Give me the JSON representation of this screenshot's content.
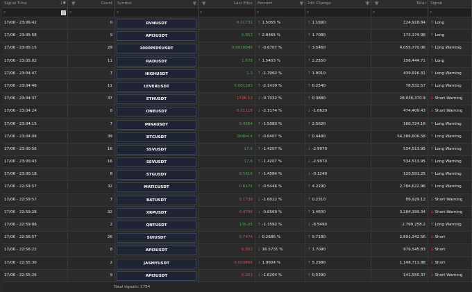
{
  "headers": [
    "Signal Time",
    "",
    "Count",
    "Symbol",
    "",
    "Last Price",
    "Percent",
    "",
    "24h Change",
    "",
    "Total",
    "Signal"
  ],
  "footer": {
    "total_label": "Total signals: 1754"
  },
  "rows": [
    {
      "time": "17/06 - 23:06:42",
      "count": "0",
      "symbol": "RVNUSDT",
      "price": "0.01731",
      "pc": "g",
      "pct_dir": "up",
      "pct": "1.5055 %",
      "ch_dir": "up",
      "change": "1.1690",
      "total": "124,918.84",
      "sig_dir": "up",
      "signal": "Long"
    },
    {
      "time": "17/06 - 23:05:58",
      "count": "9",
      "symbol": "API3USDT",
      "price": "0.953",
      "pc": "g",
      "pct_dir": "up",
      "pct": "2.8465 %",
      "ch_dir": "up",
      "change": "1.7080",
      "total": "173,174.98",
      "sig_dir": "up",
      "signal": "Long"
    },
    {
      "time": "17/06 - 23:05:15",
      "count": "29",
      "symbol": "1000PEPEUSDT",
      "price": "0.0010046",
      "pc": "g",
      "pct_dir": "up",
      "pct": "-0.6707 %",
      "ch_dir": "up",
      "change": "3.5460",
      "total": "4,055,770.06",
      "sig_dir": "up",
      "signal": "Long Warning"
    },
    {
      "time": "17/06 - 23:05:02",
      "count": "11",
      "symbol": "RADUSDT",
      "price": "1.678",
      "pc": "g",
      "pct_dir": "up",
      "pct": "1.5403 %",
      "ch_dir": "up",
      "change": "2.2550",
      "total": "156,444.71",
      "sig_dir": "up",
      "signal": "Long"
    },
    {
      "time": "17/06 - 23:04:47",
      "count": "7",
      "symbol": "HIGHUSDT",
      "price": "1.3",
      "pc": "g",
      "pct_dir": "up",
      "pct": "-1.7062 %",
      "ch_dir": "up",
      "change": "1.8010",
      "total": "439,916.31",
      "sig_dir": "up",
      "signal": "Long Warning"
    },
    {
      "time": "17/06 - 23:04:46",
      "count": "11",
      "symbol": "LEVERUSDT",
      "price": "0.001183",
      "pc": "g",
      "pct_dir": "up",
      "pct": "-2.1419 %",
      "ch_dir": "up",
      "change": "0.2540",
      "total": "78,532.57",
      "sig_dir": "up",
      "signal": "Long Warning"
    },
    {
      "time": "17/06 - 23:04:37",
      "count": "37",
      "symbol": "ETHUSDT",
      "price": "1726.13",
      "pc": "red",
      "pct_dir": "dn",
      "pct": "-0.7032 %",
      "ch_dir": "up",
      "change": "0.3880",
      "total": "28,036,370.9",
      "sig_dir": "dn",
      "signal": "Short Warning"
    },
    {
      "time": "17/06 - 23:04:24",
      "count": "8",
      "symbol": "ONEUSDT",
      "price": "0.01118",
      "pc": "red",
      "pct_dir": "dn",
      "pct": "-2.3174 %",
      "ch_dir": "dn",
      "change": "-1.0620",
      "total": "474,409.43",
      "sig_dir": "dn",
      "signal": "Short Warning"
    },
    {
      "time": "17/06 - 23:04:15",
      "count": "7",
      "symbol": "MINAUSDT",
      "price": "0.4264",
      "pc": "g",
      "pct_dir": "up",
      "pct": "-1.5080 %",
      "ch_dir": "up",
      "change": "2.5620",
      "total": "160,724.16",
      "sig_dir": "up",
      "signal": "Long Warning"
    },
    {
      "time": "17/06 - 23:04:08",
      "count": "39",
      "symbol": "BTCUSDT",
      "price": "26494.4",
      "pc": "g",
      "pct_dir": "up",
      "pct": "-0.6407 %",
      "ch_dir": "up",
      "change": "0.4480",
      "total": "54,286,606.58",
      "sig_dir": "up",
      "signal": "Long Warning"
    },
    {
      "time": "17/06 - 23:00:56",
      "count": "16",
      "symbol": "SSVUSDT",
      "price": "17.6",
      "pc": "g",
      "pct_dir": "up",
      "pct": "-1.4207 %",
      "ch_dir": "dn",
      "change": "-2.9970",
      "total": "534,513.95",
      "sig_dir": "up",
      "signal": "Long Warning"
    },
    {
      "time": "17/06 - 23:00:43",
      "count": "16",
      "symbol": "SSVUSDT",
      "price": "17.6",
      "pc": "g",
      "pct_dir": "up",
      "pct": "-1.4207 %",
      "ch_dir": "dn",
      "change": "-2.9970",
      "total": "534,513.95",
      "sig_dir": "up",
      "signal": "Long Warning"
    },
    {
      "time": "17/06 - 23:00:18",
      "count": "8",
      "symbol": "STGUSDT",
      "price": "0.5616",
      "pc": "g",
      "pct_dir": "up",
      "pct": "-1.4584 %",
      "ch_dir": "dn",
      "change": "-0.1240",
      "total": "120,591.25",
      "sig_dir": "up",
      "signal": "Long Warning"
    },
    {
      "time": "17/06 - 22:59:57",
      "count": "32",
      "symbol": "MATICUSDT",
      "price": "0.6175",
      "pc": "g",
      "pct_dir": "up",
      "pct": "-0.5446 %",
      "ch_dir": "up",
      "change": "4.2190",
      "total": "2,784,622.96",
      "sig_dir": "up",
      "signal": "Long Warning"
    },
    {
      "time": "17/06 - 22:59:57",
      "count": "7",
      "symbol": "BATUSDT",
      "price": "0.1739",
      "pc": "red",
      "pct_dir": "dn",
      "pct": "-1.6022 %",
      "ch_dir": "up",
      "change": "0.2310",
      "total": "89,929.12",
      "sig_dir": "dn",
      "signal": "Short Warning"
    },
    {
      "time": "17/06 - 22:59:28",
      "count": "32",
      "symbol": "XRPUSDT",
      "price": "0.4796",
      "pc": "red",
      "pct_dir": "dn",
      "pct": "-0.6569 %",
      "ch_dir": "up",
      "change": "1.4600",
      "total": "3,184,399.34",
      "sig_dir": "dn",
      "signal": "Short Warning"
    },
    {
      "time": "17/06 - 22:59:08",
      "count": "2",
      "symbol": "QNTUSDT",
      "price": "105.05",
      "pc": "g",
      "pct_dir": "up",
      "pct": "-1.7592 %",
      "ch_dir": "dn",
      "change": "-8.5490",
      "total": "2,799,258.2",
      "sig_dir": "up",
      "signal": "Long Warning"
    },
    {
      "time": "17/06 - 22:56:57",
      "count": "26",
      "symbol": "SUIUSDT",
      "price": "0.7474",
      "pc": "red",
      "pct_dir": "dn",
      "pct": "0.2686 %",
      "ch_dir": "up",
      "change": "9.7180",
      "total": "2,691,342.56",
      "sig_dir": "dn",
      "signal": "Short"
    },
    {
      "time": "17/06 - 22:56:22",
      "count": "8",
      "symbol": "API3USDT",
      "price": "0.952",
      "pc": "red",
      "pct_dir": "dn",
      "pct": "16.5731 %",
      "ch_dir": "up",
      "change": "1.7090",
      "total": "979,545.83",
      "sig_dir": "dn",
      "signal": "Short"
    },
    {
      "time": "17/06 - 22:55:30",
      "count": "2",
      "symbol": "JASMYUSDT",
      "price": "0.003856",
      "pc": "red",
      "pct_dir": "dn",
      "pct": "1.9604 %",
      "ch_dir": "up",
      "change": "5.2980",
      "total": "1,148,711.88",
      "sig_dir": "dn",
      "signal": "Short"
    },
    {
      "time": "17/06 - 22:55:26",
      "count": "9",
      "symbol": "API3USDT",
      "price": "0.261",
      "pc": "red",
      "pct_dir": "dn",
      "pct": "-1.6264 %",
      "ch_dir": "up",
      "change": "0.5390",
      "total": "141,550.37",
      "sig_dir": "dn",
      "signal": "Short Warning"
    }
  ]
}
